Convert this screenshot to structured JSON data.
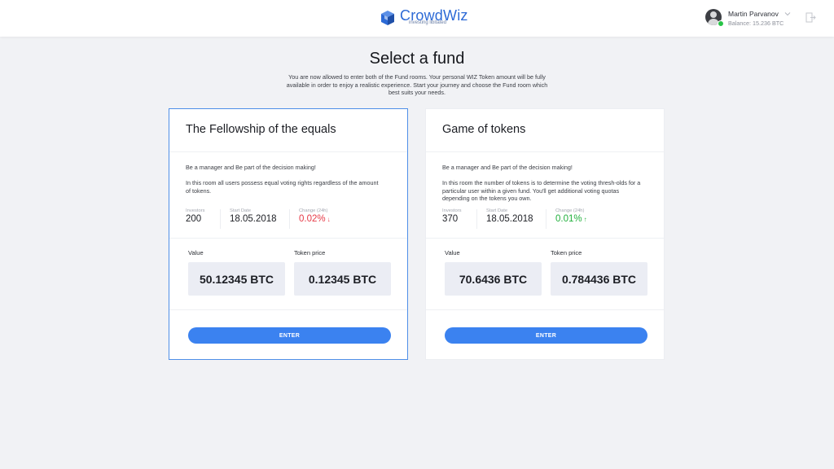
{
  "header": {
    "logo_name": "CrowdWiz",
    "logo_tagline": "investing libitated",
    "user_name": "Martin Parvanov",
    "user_balance": "Balance: 15.236 BTC",
    "icons": [
      "cube-logo-icon",
      "avatar",
      "chevron-down-icon",
      "logout-icon"
    ],
    "online_status_color": "#27c346",
    "brand_color": "#2d6ad6"
  },
  "page": {
    "title": "Select a fund",
    "intro": "You are now allowed to enter both of the Fund rooms. Your personal WIZ Token amount will be fully available in order to enjoy a realistic experience. Start your journey and choose the Fund room which best suits your needs."
  },
  "funds": [
    {
      "title": "The Fellowship of the equals",
      "tagline": "Be a manager and Be part of the decision making!",
      "description": "In this room all users possess equal voting rights regardless of the amount of tokens.",
      "investors_label": "Investors",
      "investors": "200",
      "start_date_label": "Start Date",
      "start_date": "18.05.2018",
      "change_label": "Change (24h)",
      "change": "0.02%",
      "change_direction": "down",
      "change_color": "#e63946",
      "value_label": "Value",
      "value": "50.12345 BTC",
      "token_price_label": "Token price",
      "token_price": "0.12345 BTC",
      "button": "ENTER",
      "selected": true
    },
    {
      "title": "Game of tokens",
      "tagline": "Be a manager and Be part of the decision making!",
      "description": "In this room the number of tokens is to determine the voting thresh-olds for a particular user within a given fund. You'll get additional voting quotas depending on the tokens you own.",
      "investors_label": "Investors",
      "investors": "370",
      "start_date_label": "Start Date",
      "start_date": "18.05.2018",
      "change_label": "Change (24h)",
      "change": "0.01%",
      "change_direction": "up",
      "change_color": "#21b03c",
      "value_label": "Value",
      "value": "70.6436 BTC",
      "token_price_label": "Token price",
      "token_price": "0.784436 BTC",
      "button": "ENTER",
      "selected": false
    }
  ],
  "colors": {
    "accent": "#3b82f0",
    "selected_border": "#4f8fe8",
    "background": "#f1f2f5"
  }
}
